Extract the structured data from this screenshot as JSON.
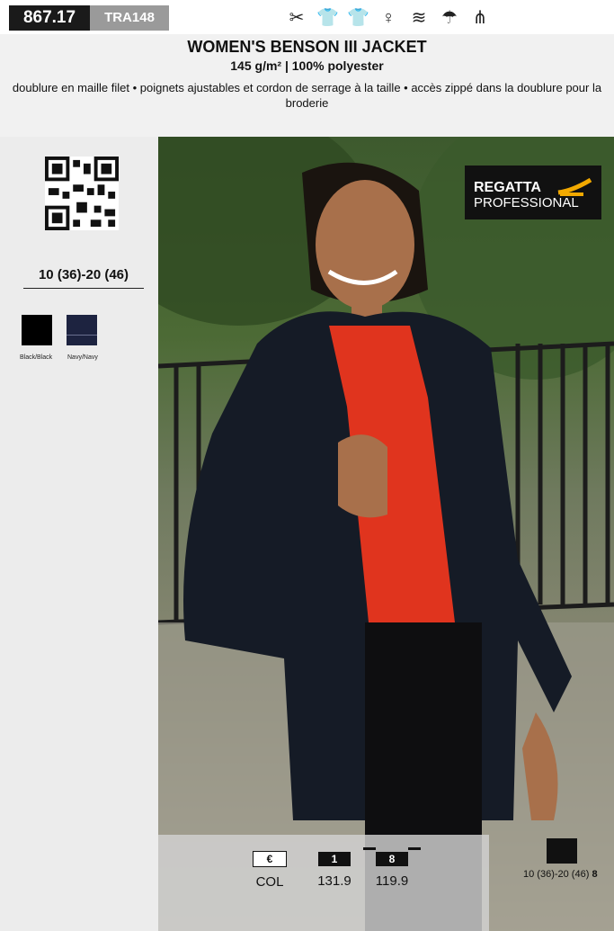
{
  "top": {
    "code": "867.17",
    "ref": "TRA148",
    "icons": [
      "tag-icon",
      "tshirt-icon",
      "tshirt-plus-icon",
      "person-icon",
      "wash-icon",
      "umbrella-icon",
      "fir-tree-icon"
    ]
  },
  "product": {
    "title": "WOMEN'S BENSON III JACKET",
    "subtitle": "145 g/m² | 100% polyester",
    "description": "doublure en maille filet • poignets ajustables et cordon de serrage à la taille • accès zippé dans la doublure pour la broderie"
  },
  "sidebar": {
    "sizes": "10 (36)-20 (46)",
    "colors": [
      {
        "label": "Black/Black",
        "hex": "#000000"
      },
      {
        "label": "Navy/Navy",
        "hex": "#1d2340"
      }
    ]
  },
  "brand": {
    "line1": "REGATTA",
    "line2": "PROFESSIONAL",
    "accent": "#f2a900"
  },
  "pricing": {
    "currency": "€",
    "currency_label": "COL",
    "qty1": "1",
    "price1": "131.9",
    "qty8": "8",
    "price8": "119.9"
  },
  "packaging": {
    "size_range": "10 (36)-20 (46)",
    "qty": "8"
  }
}
